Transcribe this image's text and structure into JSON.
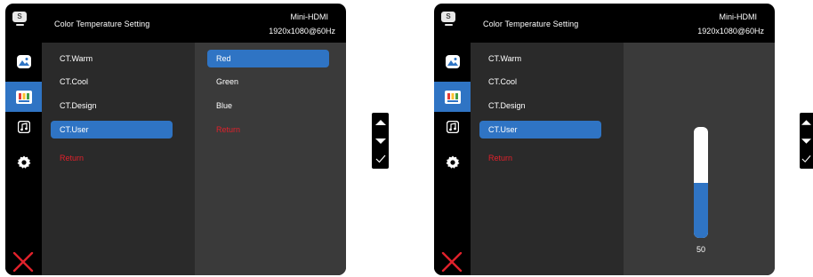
{
  "panels": [
    {
      "header": {
        "title": "Color Temperature Setting",
        "input": "Mini-HDMI",
        "resolution": "1920x1080@60Hz"
      },
      "main_menu": [
        "CT.Warm",
        "CT.Cool",
        "CT.Design",
        "CT.User"
      ],
      "return_label": "Return",
      "sub_menu": [
        "Red",
        "Green",
        "Blue"
      ],
      "sub_return": "Return",
      "selected_main": "CT.User",
      "selected_sub": "Red"
    },
    {
      "header": {
        "title": "Color Temperature Setting",
        "input": "Mini-HDMI",
        "resolution": "1920x1080@60Hz"
      },
      "main_menu": [
        "CT.Warm",
        "CT.Cool",
        "CT.Design",
        "CT.User"
      ],
      "return_label": "Return",
      "selected_main": "CT.User",
      "slider_value": "50",
      "slider_level": 0.5
    }
  ],
  "rail_icons": [
    "picture-icon",
    "color-bars-icon",
    "music-icon",
    "gear-icon"
  ],
  "logo_letter": "S",
  "nav_keys": [
    "up-arrow-icon",
    "down-arrow-icon",
    "check-icon"
  ],
  "colors": {
    "accent": "#2f74c4",
    "return_red": "#e0212b",
    "close_red": "#e0212b"
  }
}
